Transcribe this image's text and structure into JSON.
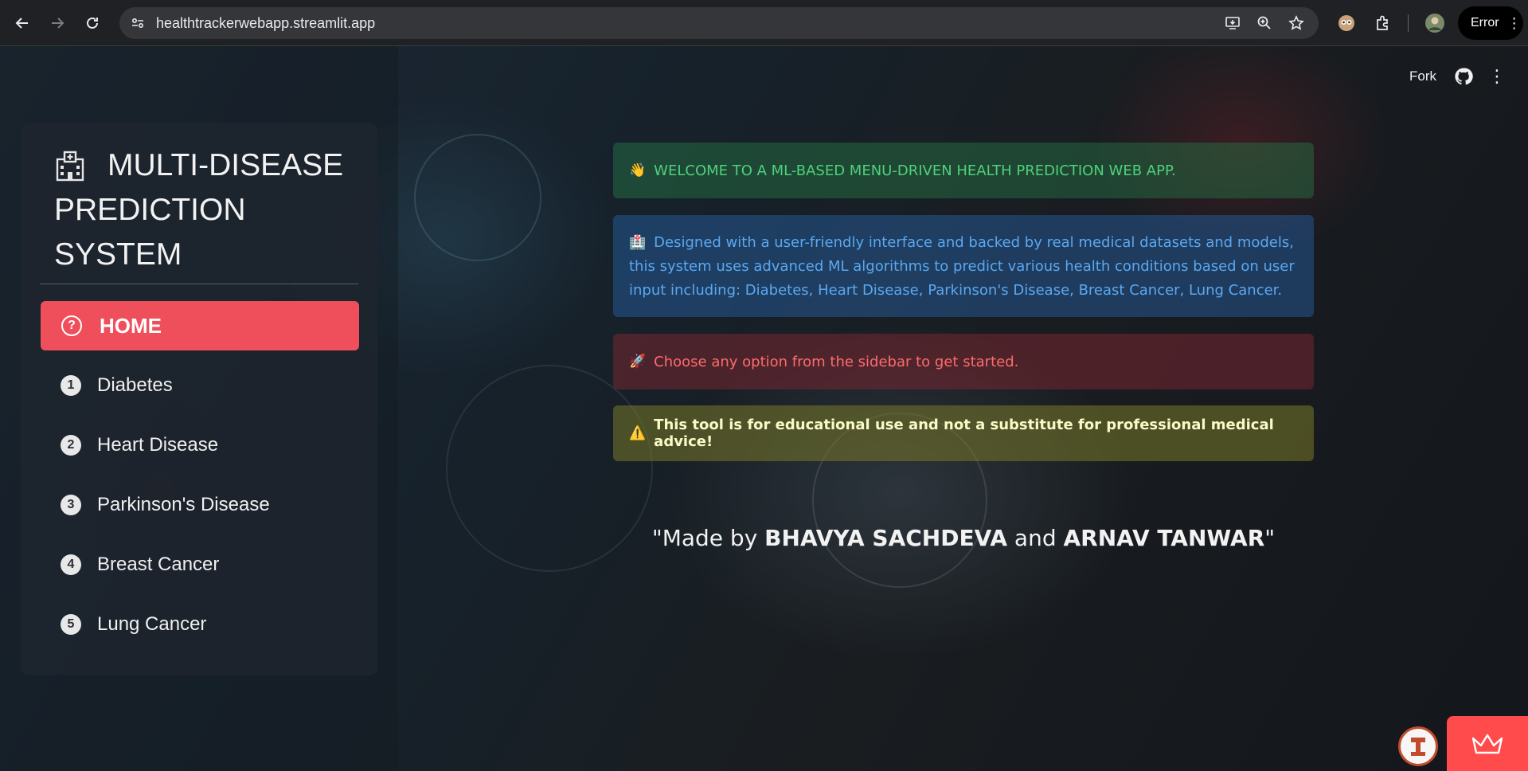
{
  "browser": {
    "url": "healthtrackerwebapp.streamlit.app",
    "profile_status": "Error",
    "icons": [
      "back-arrow-icon",
      "forward-arrow-icon",
      "reload-icon",
      "site-info-icon",
      "install-app-icon",
      "zoom-icon",
      "star-icon",
      "extension-avatar-icon",
      "extensions-puzzle-icon",
      "profile-avatar-icon",
      "menu-dots-icon"
    ]
  },
  "toolbar": {
    "fork_label": "Fork",
    "github_icon": "github-icon",
    "menu_icon": "kebab-menu-icon"
  },
  "sidebar": {
    "title": "MULTI-DISEASE PREDICTION SYSTEM",
    "title_icon": "hospital-icon",
    "items": [
      {
        "label": "HOME",
        "icon": "question-circle-icon",
        "active": true
      },
      {
        "label": "Diabetes",
        "number": "1"
      },
      {
        "label": "Heart Disease",
        "number": "2"
      },
      {
        "label": "Parkinson's Disease",
        "number": "3"
      },
      {
        "label": "Breast Cancer",
        "number": "4"
      },
      {
        "label": "Lung Cancer",
        "number": "5"
      }
    ]
  },
  "main": {
    "welcome": {
      "emoji": "👋",
      "text": "WELCOME TO A ML-BASED MENU-DRIVEN HEALTH PREDICTION WEB APP."
    },
    "info": {
      "emoji": "🏥",
      "text": "Designed with a user-friendly interface and backed by real medical datasets and models, this system uses advanced ML algorithms to predict various health conditions based on user input including: Diabetes, Heart Disease, Parkinson's Disease, Breast Cancer, Lung Cancer."
    },
    "start": {
      "emoji": "🚀",
      "text": "Choose any option from the sidebar to get started."
    },
    "warning": {
      "emoji": "⚠️",
      "text": "This tool is for educational use and not a substitute for professional medical advice!"
    },
    "credit": {
      "prefix": "\"Made by ",
      "author1": "BHAVYA SACHDEVA",
      "joiner": " and ",
      "author2": "ARNAV TANWAR",
      "suffix": "\""
    }
  },
  "colors": {
    "accent": "#ef4f5b",
    "success_text": "#4ed27a",
    "info_text": "#5aa8f2",
    "error_text": "#ff6b6b",
    "streamlit_red": "#ff4b4b"
  }
}
